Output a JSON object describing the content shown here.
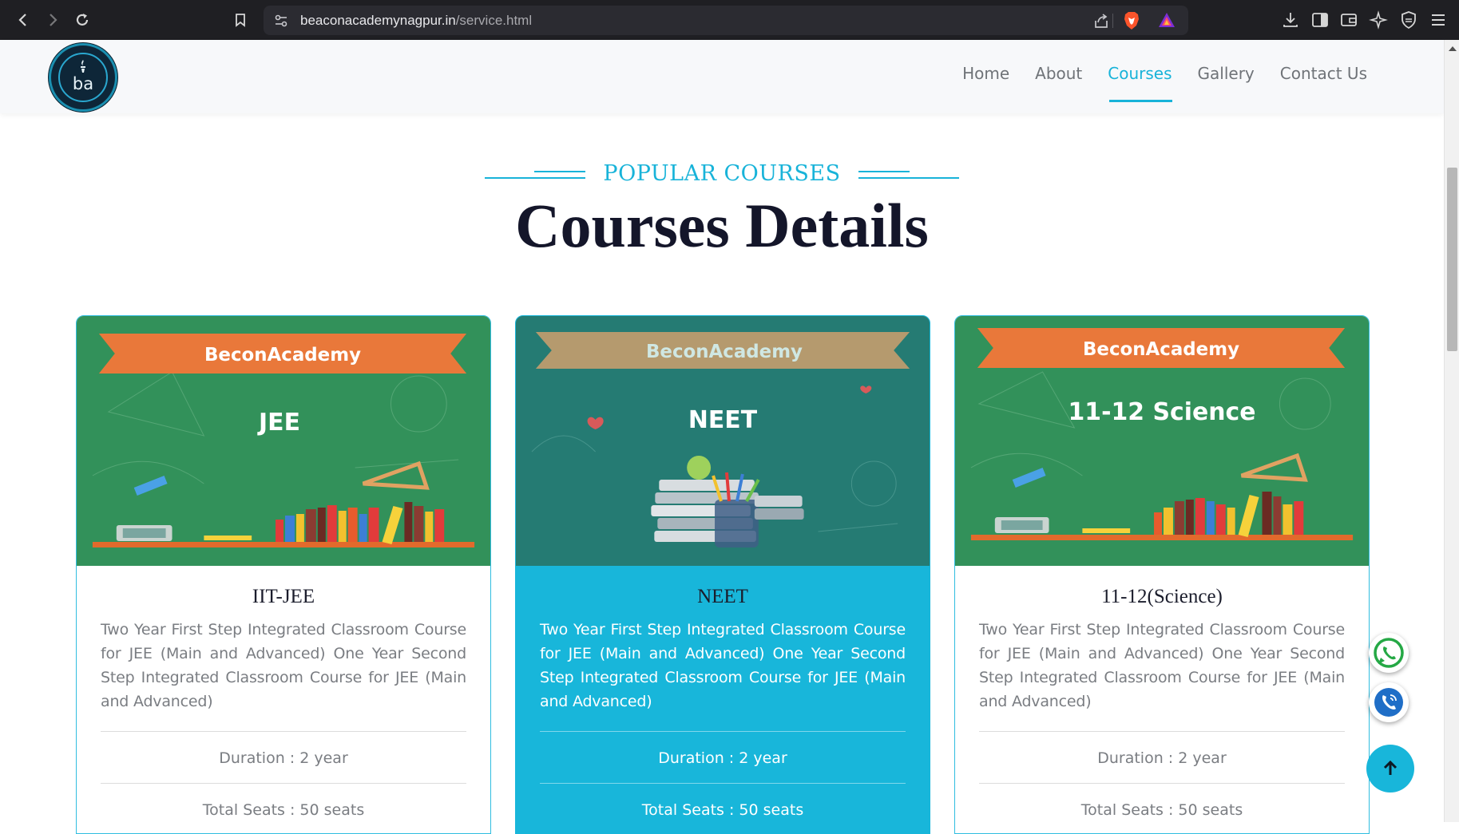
{
  "browser": {
    "url_domain": "beaconacademynagpur.in",
    "url_path": "/service.html"
  },
  "header": {
    "logo_text": "ba",
    "menu": [
      {
        "label": "Home",
        "active": false
      },
      {
        "label": "About",
        "active": false
      },
      {
        "label": "Courses",
        "active": true
      },
      {
        "label": "Gallery",
        "active": false
      },
      {
        "label": "Contact Us",
        "active": false
      }
    ]
  },
  "section": {
    "subtitle": "POPULAR COURSES",
    "title": "Courses Details"
  },
  "cards": [
    {
      "banner": "BeconAcademy",
      "image_caption": "JEE",
      "title": "IIT-JEE",
      "description": "Two Year First Step Integrated Classroom Course for JEE (Main and Advanced) One Year Second Step Integrated Classroom Course for JEE (Main and Advanced)",
      "duration": "Duration : 2 year",
      "seats": "Total Seats : 50 seats"
    },
    {
      "banner": "BeconAcademy",
      "image_caption": "NEET",
      "title": "NEET",
      "description": "Two Year First Step Integrated Classroom Course for JEE (Main and Advanced) One Year Second Step Integrated Classroom Course for JEE (Main and Advanced)",
      "duration": "Duration : 2 year",
      "seats": "Total Seats : 50 seats"
    },
    {
      "banner": "BeconAcademy",
      "image_caption": "11-12 Science",
      "title": "11-12(Science)",
      "description": "Two Year First Step Integrated Classroom Course for JEE (Main and Advanced) One Year Second Step Integrated Classroom Course for JEE (Main and Advanced)",
      "duration": "Duration : 2 year",
      "seats": "Total Seats : 50 seats"
    }
  ],
  "colors": {
    "accent": "#18b3d9",
    "title": "#14162a",
    "chalkboard_green": "#2e8b57",
    "chalkboard_teal": "#227a72",
    "banner_orange": "#e9783a",
    "banner_tan": "#b59a6e"
  },
  "icons": {
    "whatsapp": "whatsapp-icon",
    "call": "phone-icon",
    "back_to_top": "arrow-up-icon"
  }
}
